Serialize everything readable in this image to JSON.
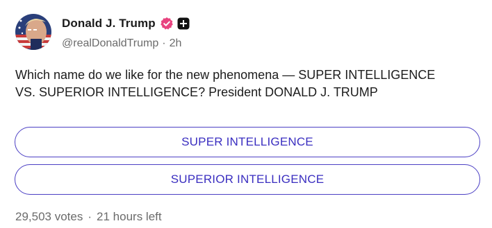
{
  "author": {
    "display_name": "Donald J. Trump",
    "handle": "@realDonaldTrump",
    "time_ago": "2h",
    "meta_separator": "·",
    "badges": [
      "verified-icon",
      "plus-icon"
    ]
  },
  "post": {
    "text_line_1": "Which name do we like for the new phenomena — SUPER INTELLIGENCE",
    "text_line_2": "VS. SUPERIOR INTELLIGENCE? President DONALD J. TRUMP"
  },
  "poll": {
    "options": [
      {
        "label": "SUPER INTELLIGENCE"
      },
      {
        "label": "SUPERIOR INTELLIGENCE"
      }
    ],
    "votes": "29,503 votes",
    "separator": "·",
    "time_left": "21 hours left"
  },
  "colors": {
    "accent": "#4b3fc4",
    "verified_badge": "#e8437f",
    "muted_text": "#6b6b6b",
    "text": "#1c1c1c"
  }
}
